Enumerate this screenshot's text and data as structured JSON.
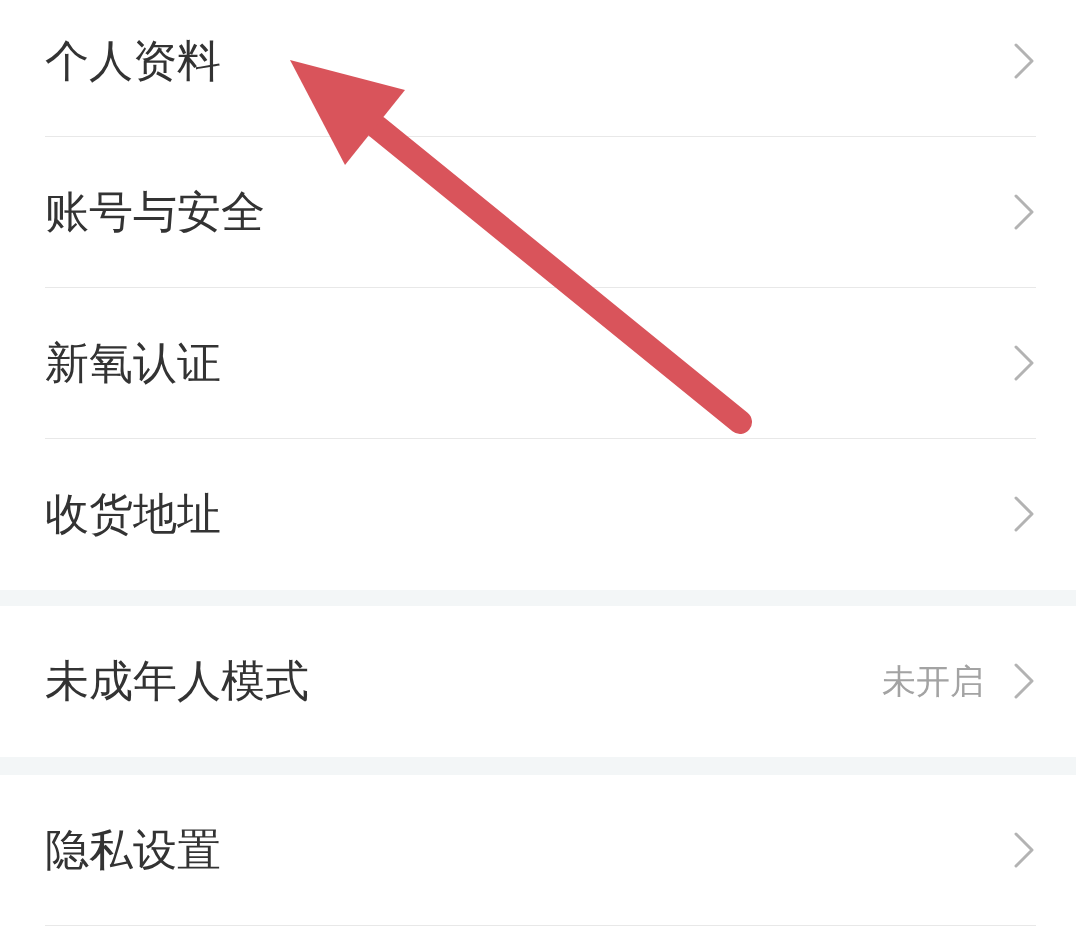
{
  "groups": [
    {
      "items": [
        {
          "label": "个人资料"
        },
        {
          "label": "账号与安全"
        },
        {
          "label": "新氧认证"
        },
        {
          "label": "收货地址"
        }
      ]
    },
    {
      "items": [
        {
          "label": "未成年人模式",
          "value": "未开启"
        }
      ]
    },
    {
      "items": [
        {
          "label": "隐私设置"
        }
      ]
    }
  ]
}
